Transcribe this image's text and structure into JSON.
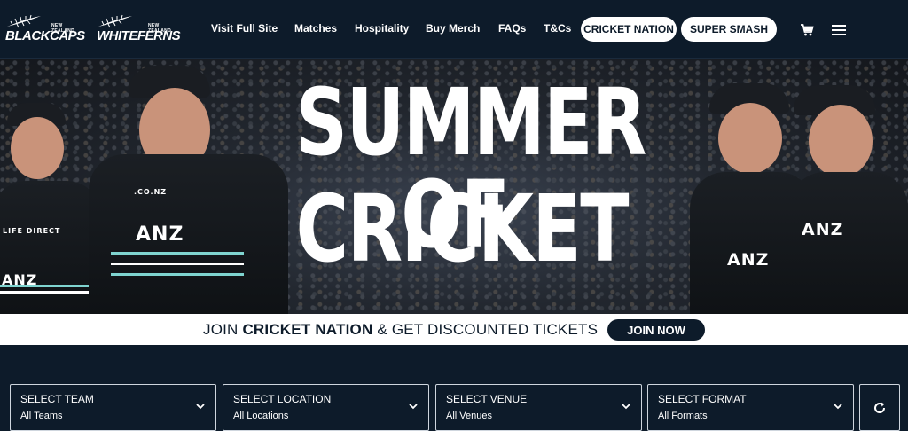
{
  "brand": {
    "logo1": {
      "small": "NEW ZEALAND",
      "big": "BLACKCAPS"
    },
    "logo2": {
      "small": "NEW ZEALAND",
      "big": "WHITEFERNS"
    }
  },
  "nav": {
    "links": [
      "Visit Full Site",
      "Matches",
      "Hospitality",
      "Buy Merch",
      "FAQs",
      "T&Cs"
    ],
    "pills": [
      "CRICKET NATION",
      "SUPER SMASH"
    ],
    "icons": [
      "cart-icon",
      "menu-icon"
    ]
  },
  "hero": {
    "line1": "SUMMER OF",
    "line2": "CRICKET",
    "sponsors": {
      "anz": "ANZ",
      "lifedirect1": "LIFE DIRECT",
      "lifedirect2": ".CO.NZ"
    }
  },
  "banner": {
    "pre": "JOIN ",
    "bold": "CRICKET NATION",
    "post": " & GET DISCOUNTED TICKETS",
    "button": "JOIN NOW"
  },
  "filters": [
    {
      "label": "SELECT TEAM",
      "value": "All Teams"
    },
    {
      "label": "SELECT LOCATION",
      "value": "All Locations"
    },
    {
      "label": "SELECT VENUE",
      "value": "All Venues"
    },
    {
      "label": "SELECT FORMAT",
      "value": "All Formats"
    }
  ],
  "colors": {
    "navy": "#0d1b2a",
    "white": "#ffffff",
    "teal": "#7fd4d0",
    "anzBlue": "#1a9ad6"
  }
}
